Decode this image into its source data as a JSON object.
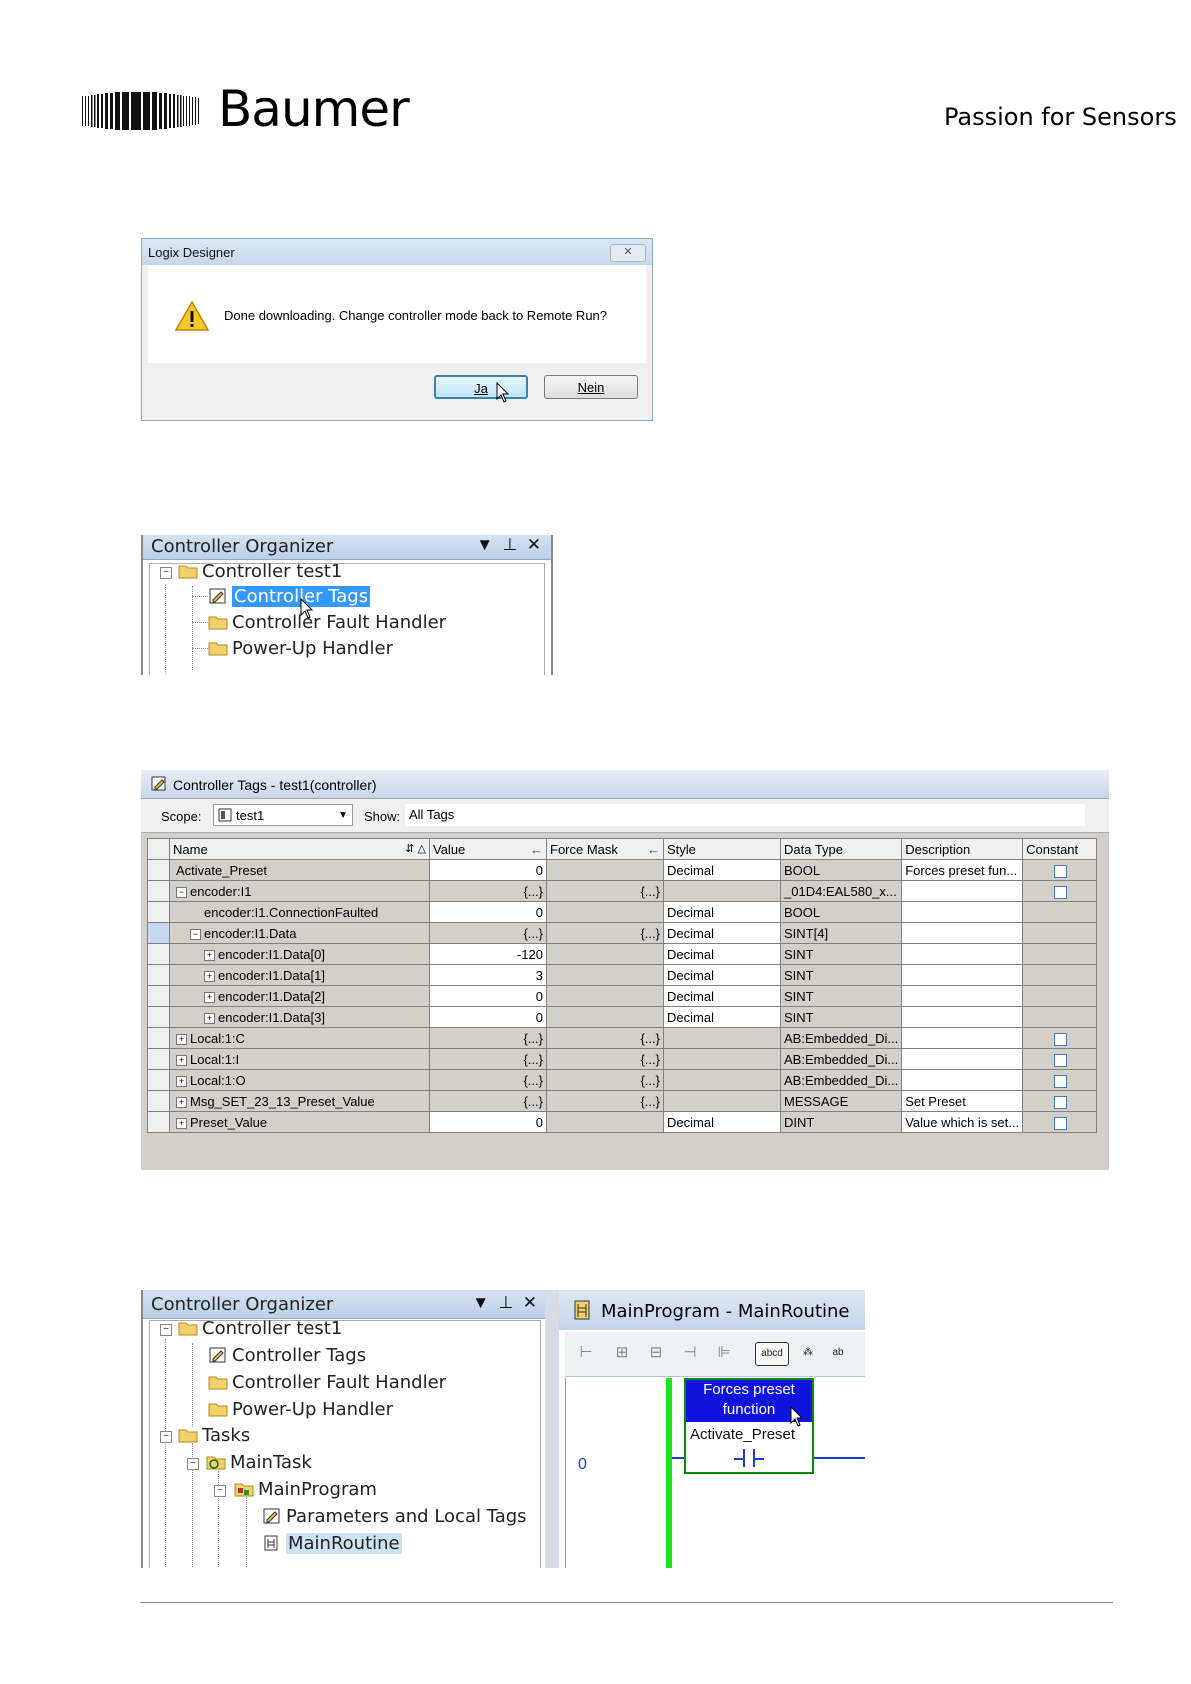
{
  "header": {
    "brand": "Baumer",
    "tagline": "Passion for Sensors"
  },
  "dialog": {
    "title": "Logix Designer",
    "close_label": "✕",
    "message": "Done downloading. Change controller mode back to Remote Run?",
    "yes_label": "Ja",
    "no_label": "Nein"
  },
  "organizer1": {
    "title": "Controller Organizer",
    "items": [
      {
        "label": "Controller test1"
      },
      {
        "label": "Controller Tags"
      },
      {
        "label": "Controller Fault Handler"
      },
      {
        "label": "Power-Up Handler"
      }
    ]
  },
  "tags_window": {
    "title": "Controller Tags - test1(controller)",
    "scope_label": "Scope:",
    "scope_value": "test1",
    "show_label": "Show:",
    "show_value": "All Tags",
    "columns": [
      "Name",
      "Value",
      "Force Mask",
      "Style",
      "Data Type",
      "Description",
      "Constant"
    ],
    "rows": [
      {
        "name": "Activate_Preset",
        "value": "0",
        "mask": "",
        "style": "Decimal",
        "dtype": "BOOL",
        "desc": "Forces preset fun...",
        "constant": true
      },
      {
        "name": "encoder:I1",
        "value": "{...}",
        "mask": "{...}",
        "style": "",
        "dtype": "_01D4:EAL580_x...",
        "desc": "",
        "constant": true
      },
      {
        "name": "encoder:I1.ConnectionFaulted",
        "value": "0",
        "mask": "",
        "style": "Decimal",
        "dtype": "BOOL",
        "desc": "",
        "constant": false
      },
      {
        "name": "encoder:I1.Data",
        "value": "{...}",
        "mask": "{...}",
        "style": "Decimal",
        "dtype": "SINT[4]",
        "desc": "",
        "constant": false
      },
      {
        "name": "encoder:I1.Data[0]",
        "value": "-120",
        "mask": "",
        "style": "Decimal",
        "dtype": "SINT",
        "desc": "",
        "constant": false
      },
      {
        "name": "encoder:I1.Data[1]",
        "value": "3",
        "mask": "",
        "style": "Decimal",
        "dtype": "SINT",
        "desc": "",
        "constant": false
      },
      {
        "name": "encoder:I1.Data[2]",
        "value": "0",
        "mask": "",
        "style": "Decimal",
        "dtype": "SINT",
        "desc": "",
        "constant": false
      },
      {
        "name": "encoder:I1.Data[3]",
        "value": "0",
        "mask": "",
        "style": "Decimal",
        "dtype": "SINT",
        "desc": "",
        "constant": false
      },
      {
        "name": "Local:1:C",
        "value": "{...}",
        "mask": "{...}",
        "style": "",
        "dtype": "AB:Embedded_Di...",
        "desc": "",
        "constant": true
      },
      {
        "name": "Local:1:I",
        "value": "{...}",
        "mask": "{...}",
        "style": "",
        "dtype": "AB:Embedded_Di...",
        "desc": "",
        "constant": true
      },
      {
        "name": "Local:1:O",
        "value": "{...}",
        "mask": "{...}",
        "style": "",
        "dtype": "AB:Embedded_Di...",
        "desc": "",
        "constant": true
      },
      {
        "name": "Msg_SET_23_13_Preset_Value",
        "value": "{...}",
        "mask": "{...}",
        "style": "",
        "dtype": "MESSAGE",
        "desc": "Set Preset",
        "constant": true
      },
      {
        "name": "Preset_Value",
        "value": "0",
        "mask": "",
        "style": "Decimal",
        "dtype": "DINT",
        "desc": "Value which is set...",
        "constant": true
      }
    ]
  },
  "organizer2": {
    "title": "Controller Organizer",
    "items": [
      {
        "label": "Controller test1"
      },
      {
        "label": "Controller Tags"
      },
      {
        "label": "Controller Fault Handler"
      },
      {
        "label": "Power-Up Handler"
      },
      {
        "label": "Tasks"
      },
      {
        "label": "MainTask"
      },
      {
        "label": "MainProgram"
      },
      {
        "label": "Parameters and Local Tags"
      },
      {
        "label": "MainRoutine"
      }
    ]
  },
  "routine": {
    "title": "MainProgram - MainRoutine",
    "toolbar_text_button": "abcd",
    "rung_number": "0",
    "instruction_description": "Forces preset function",
    "instruction_tag": "Activate_Preset"
  }
}
